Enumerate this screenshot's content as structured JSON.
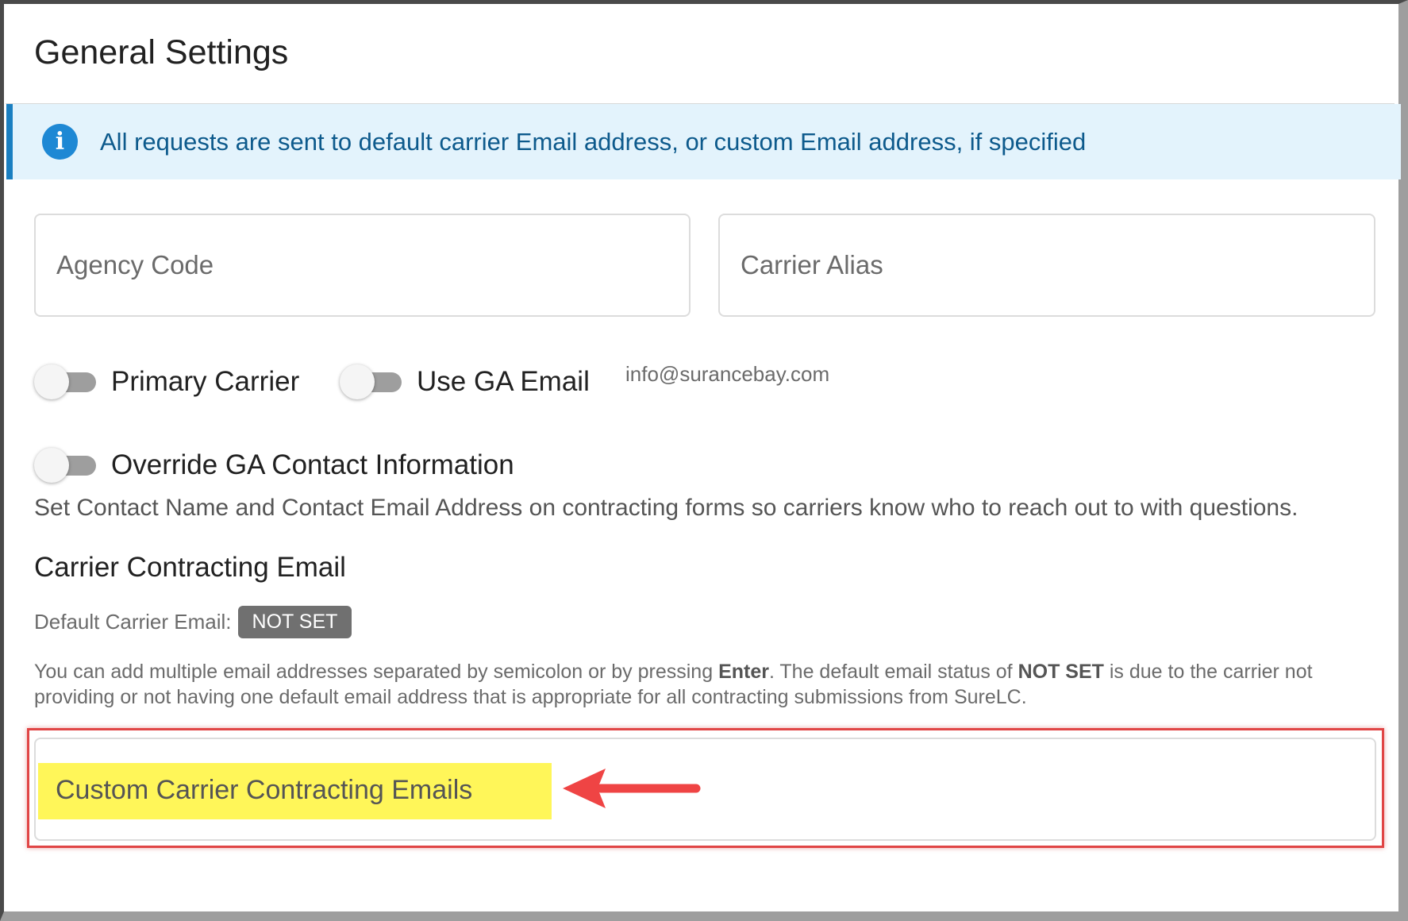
{
  "page": {
    "title": "General Settings"
  },
  "alert": {
    "icon": "info-icon",
    "glyph": "i",
    "text": "All requests are sent to default carrier Email address, or custom Email address, if specified"
  },
  "fields": {
    "agency_code_placeholder": "Agency Code",
    "carrier_alias_placeholder": "Carrier Alias"
  },
  "toggles": {
    "primary_carrier": {
      "label": "Primary Carrier",
      "on": false
    },
    "use_ga_email": {
      "label": "Use GA Email",
      "on": false
    },
    "ga_email_address": "info@surancebay.com",
    "override_contact": {
      "label": "Override GA Contact Information",
      "on": false
    },
    "override_description": "Set Contact Name and Contact Email Address on contracting forms so carriers know who to reach out to with questions."
  },
  "contracting": {
    "section_title": "Carrier Contracting Email",
    "default_label": "Default Carrier Email:",
    "default_status": "NOT SET",
    "help_part1": "You can add multiple email addresses separated by semicolon or by pressing ",
    "help_enter": "Enter",
    "help_part2": ". The default email status of ",
    "help_notset": "NOT SET",
    "help_part3": " is due to the carrier not providing or not having one default email address that is appropriate for all contracting submissions from SureLC.",
    "custom_label": "Custom Carrier Contracting Emails"
  },
  "annotation": {
    "highlight_color": "#fff659",
    "box_color": "#e04545",
    "arrow_color": "#ef4444"
  }
}
